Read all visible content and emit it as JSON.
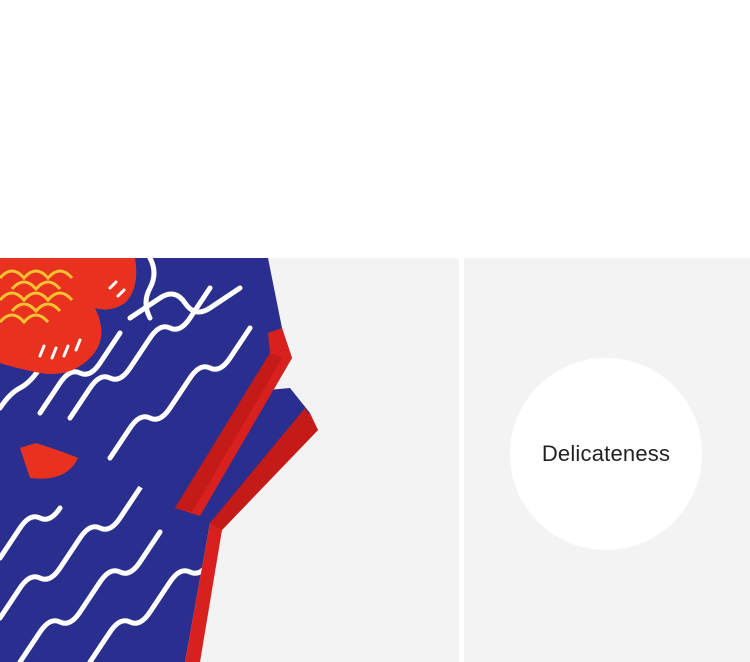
{
  "feature": {
    "label": "Delicateness"
  },
  "colors": {
    "background": "#ffffff",
    "panel": "#f3f3f3",
    "sock_blue": "#2a2f8f",
    "sock_red": "#d8201e",
    "koi_red": "#e8321f",
    "koi_scale_yellow": "#f2c230",
    "wave_white": "#ffffff"
  },
  "image": {
    "subject": "product-photo-sock-cuff-koi-wave-pattern"
  }
}
